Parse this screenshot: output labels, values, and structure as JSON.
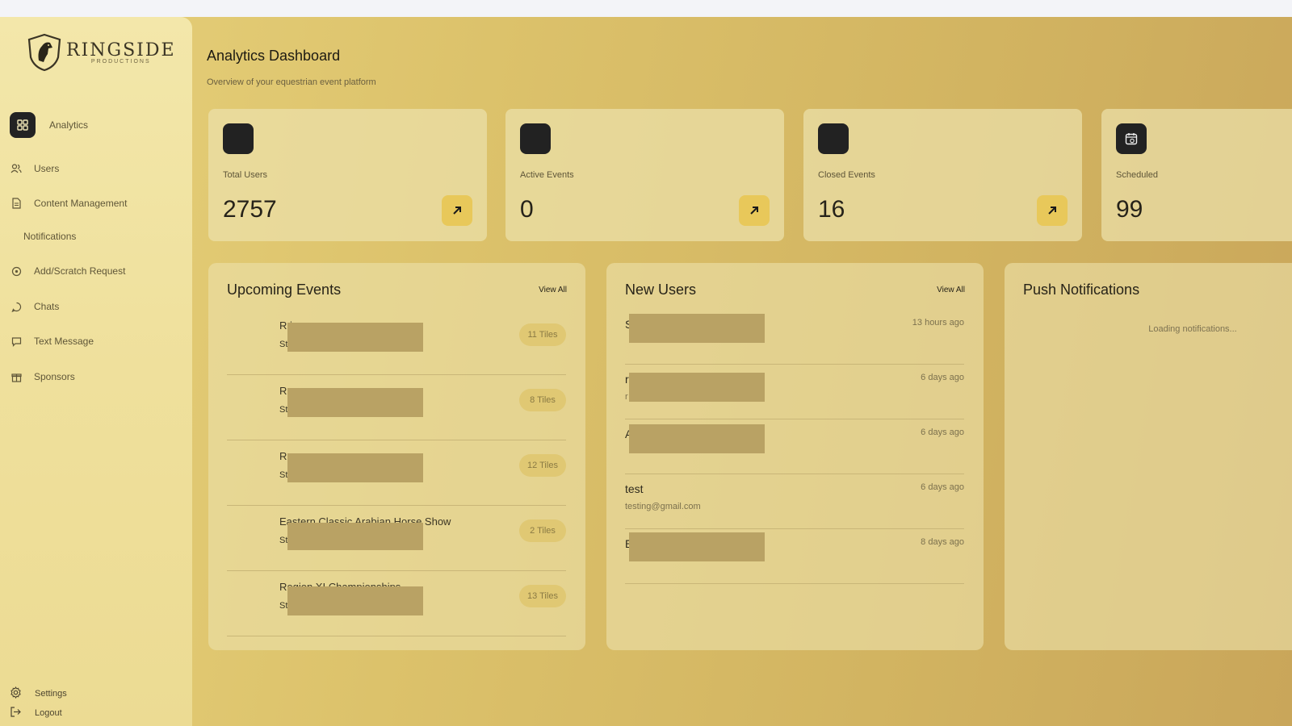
{
  "brand": {
    "name": "RINGSIDE",
    "tagline": "PRODUCTIONS"
  },
  "sidebar": {
    "items": [
      {
        "label": "Analytics",
        "icon": "grid-icon",
        "active": true
      },
      {
        "label": "Users",
        "icon": "users-icon"
      },
      {
        "label": "Content Management",
        "icon": "document-icon"
      },
      {
        "label": "Notifications",
        "icon": ""
      },
      {
        "label": "Add/Scratch Request",
        "icon": "circle-plus-icon"
      },
      {
        "label": "Chats",
        "icon": "chat-bubble-icon"
      },
      {
        "label": "Text Message",
        "icon": "message-square-icon"
      },
      {
        "label": "Sponsors",
        "icon": "gift-icon"
      }
    ],
    "bottom": [
      {
        "label": "Settings",
        "icon": "gear-icon"
      },
      {
        "label": "Logout",
        "icon": "logout-icon"
      }
    ]
  },
  "header": {
    "title": "Analytics Dashboard",
    "subtitle": "Overview of your equestrian event platform"
  },
  "stats": [
    {
      "label": "Total Users",
      "value": "2757"
    },
    {
      "label": "Active Events",
      "value": "0"
    },
    {
      "label": "Closed Events",
      "value": "16"
    },
    {
      "label": "Scheduled",
      "value": "99"
    }
  ],
  "upcoming_events": {
    "title": "Upcoming Events",
    "view_all": "View All",
    "rows": [
      {
        "title": "R                        ips",
        "sub": "St",
        "badge": "11 Tiles"
      },
      {
        "title": "R",
        "sub": "St",
        "badge": "8 Tiles"
      },
      {
        "title": "R",
        "sub": "St",
        "badge": "12 Tiles"
      },
      {
        "title": "Eastern Classic Arabian Horse Show",
        "sub": "St",
        "badge": "2 Tiles"
      },
      {
        "title": "Region XI Championships",
        "sub": "St",
        "badge": "13 Tiles"
      }
    ]
  },
  "new_users": {
    "title": "New Users",
    "view_all": "View All",
    "rows": [
      {
        "name": "S",
        "email": "",
        "time": "13 hours ago",
        "redacted": true
      },
      {
        "name": "r",
        "email": "r",
        "time": "6 days ago",
        "redacted": true
      },
      {
        "name": "A",
        "email": "",
        "time": "6 days ago",
        "redacted": true
      },
      {
        "name": "test",
        "email": "testing@gmail.com",
        "time": "6 days ago",
        "redacted": false
      },
      {
        "name": "E",
        "email": "",
        "time": "8 days ago",
        "redacted": true
      }
    ]
  },
  "push_notifications": {
    "title": "Push Notifications",
    "status": "Loading notifications..."
  },
  "colors": {
    "accent": "#e8c85a",
    "dark": "#222222",
    "redaction": "#b9a264"
  }
}
